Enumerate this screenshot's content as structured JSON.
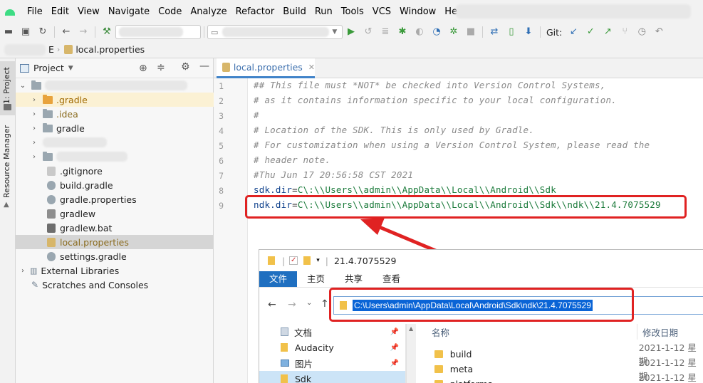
{
  "menu": {
    "items": [
      "File",
      "Edit",
      "View",
      "Navigate",
      "Code",
      "Analyze",
      "Refactor",
      "Build",
      "Run",
      "Tools",
      "VCS",
      "Window",
      "Help"
    ]
  },
  "toolbar": {
    "git_label": "Git:"
  },
  "navbar": {
    "crumb_tail": "E",
    "file": "local.properties"
  },
  "sidebar_strip": {
    "project_label": "1: Project",
    "resource_label": "Resource Manager"
  },
  "project_panel": {
    "title": "Project",
    "tree": [
      {
        "label": ".gradle",
        "kind": "folder",
        "color": "#e8a33d"
      },
      {
        "label": ".idea",
        "kind": "folder",
        "color": "#9aa7b0"
      },
      {
        "label": "gradle",
        "kind": "folder",
        "color": "#9aa7b0"
      },
      {
        "label": ".gitignore",
        "kind": "file"
      },
      {
        "label": "build.gradle",
        "kind": "gradle"
      },
      {
        "label": "gradle.properties",
        "kind": "gradle"
      },
      {
        "label": "gradlew",
        "kind": "file"
      },
      {
        "label": "gradlew.bat",
        "kind": "file"
      },
      {
        "label": "local.properties",
        "kind": "props",
        "selected": true
      },
      {
        "label": "settings.gradle",
        "kind": "gradle"
      },
      {
        "label": "External Libraries",
        "kind": "libs"
      },
      {
        "label": "Scratches and Consoles",
        "kind": "scratch"
      }
    ]
  },
  "editor": {
    "tab_label": "local.properties",
    "lines": [
      {
        "n": "1",
        "text": "## This file must *NOT* be checked into Version Control Systems,"
      },
      {
        "n": "2",
        "text": "# as it contains information specific to your local configuration."
      },
      {
        "n": "3",
        "text": "#"
      },
      {
        "n": "4",
        "text": "# Location of the SDK. This is only used by Gradle."
      },
      {
        "n": "5",
        "text": "# For customization when using a Version Control System, please read the"
      },
      {
        "n": "6",
        "text": "# header note."
      },
      {
        "n": "7",
        "text": "#Thu Jun 17 20:56:58 CST 2021"
      },
      {
        "n": "8",
        "key": "sdk.dir",
        "value": "C\\:\\\\Users\\\\admin\\\\AppData\\\\Local\\\\Android\\\\Sdk"
      },
      {
        "n": "9",
        "key": "ndk.dir",
        "value": "C\\:\\\\Users\\\\admin\\\\AppData\\\\Local\\\\Android\\\\Sdk\\\\ndk\\\\21.4.7075529"
      }
    ],
    "eq": "="
  },
  "explorer": {
    "title": "21.4.7075529",
    "ribbon_tabs": [
      "文件",
      "主页",
      "共享",
      "查看"
    ],
    "address": "C:\\Users\\admin\\AppData\\Local\\Android\\Sdk\\ndk\\21.4.7075529",
    "nav_items": [
      {
        "label": "文档"
      },
      {
        "label": "Audacity"
      },
      {
        "label": "图片"
      },
      {
        "label": "Sdk",
        "selected": true
      }
    ],
    "columns": {
      "name": "名称",
      "date": "修改日期"
    },
    "files": [
      {
        "name": "build",
        "date": "2021-1-12 星期"
      },
      {
        "name": "meta",
        "date": "2021-1-12 星期"
      },
      {
        "name": "platforms",
        "date": "2021-1-12 星期"
      }
    ]
  },
  "colors": {
    "annotation_red": "#e02222",
    "accent_blue": "#1f6fc0",
    "selection_blue": "#0a64d6"
  }
}
